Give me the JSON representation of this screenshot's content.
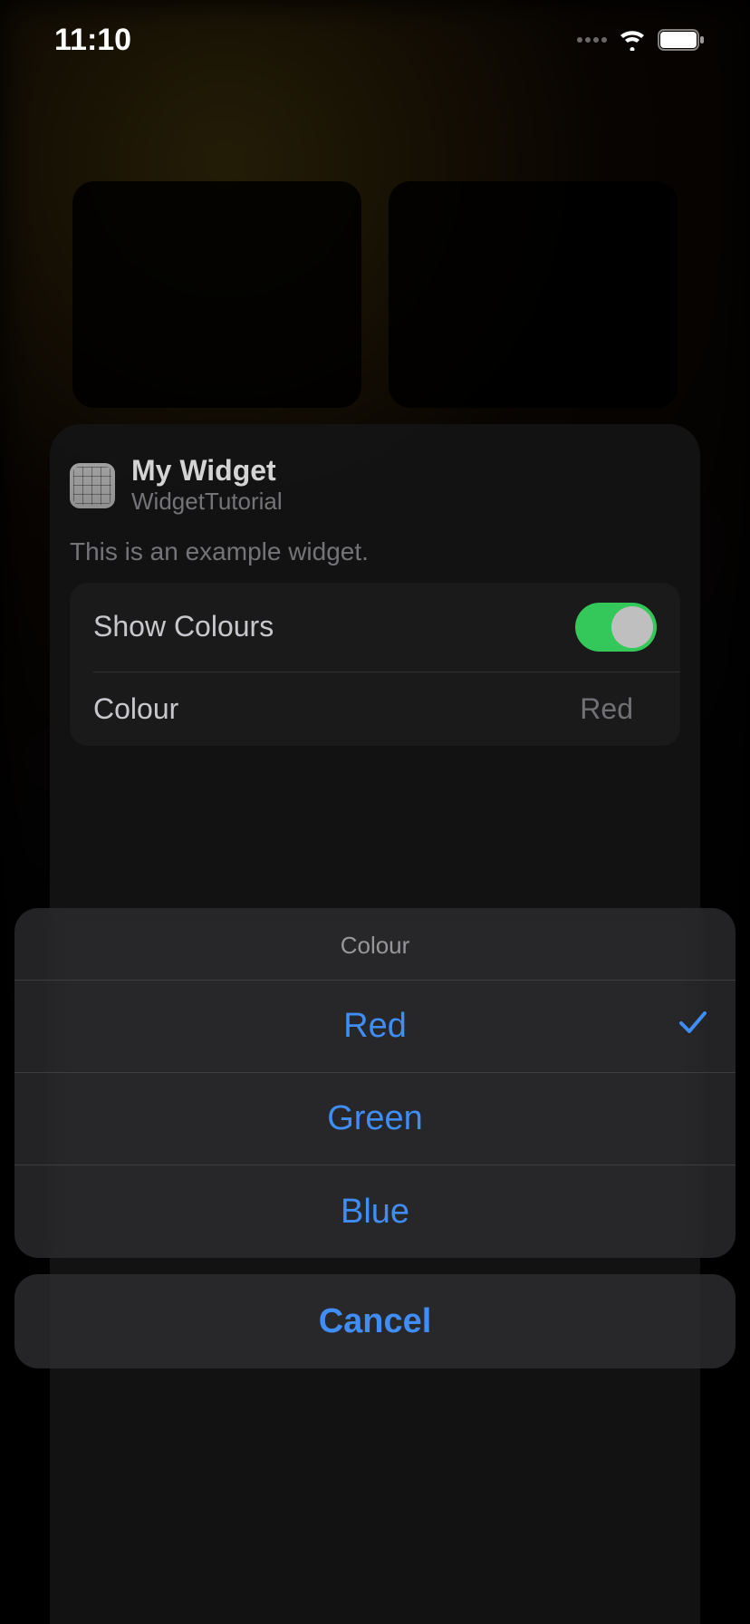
{
  "status_bar": {
    "time": "11:10"
  },
  "widget": {
    "title": "My Widget",
    "subtitle": "WidgetTutorial",
    "description": "This is an example widget.",
    "settings": {
      "show_colours_label": "Show Colours",
      "show_colours_on": true,
      "colour_label": "Colour",
      "colour_value": "Red"
    }
  },
  "action_sheet": {
    "title": "Colour",
    "options": [
      {
        "label": "Red",
        "selected": true
      },
      {
        "label": "Green",
        "selected": false
      },
      {
        "label": "Blue",
        "selected": false
      }
    ],
    "cancel_label": "Cancel"
  }
}
